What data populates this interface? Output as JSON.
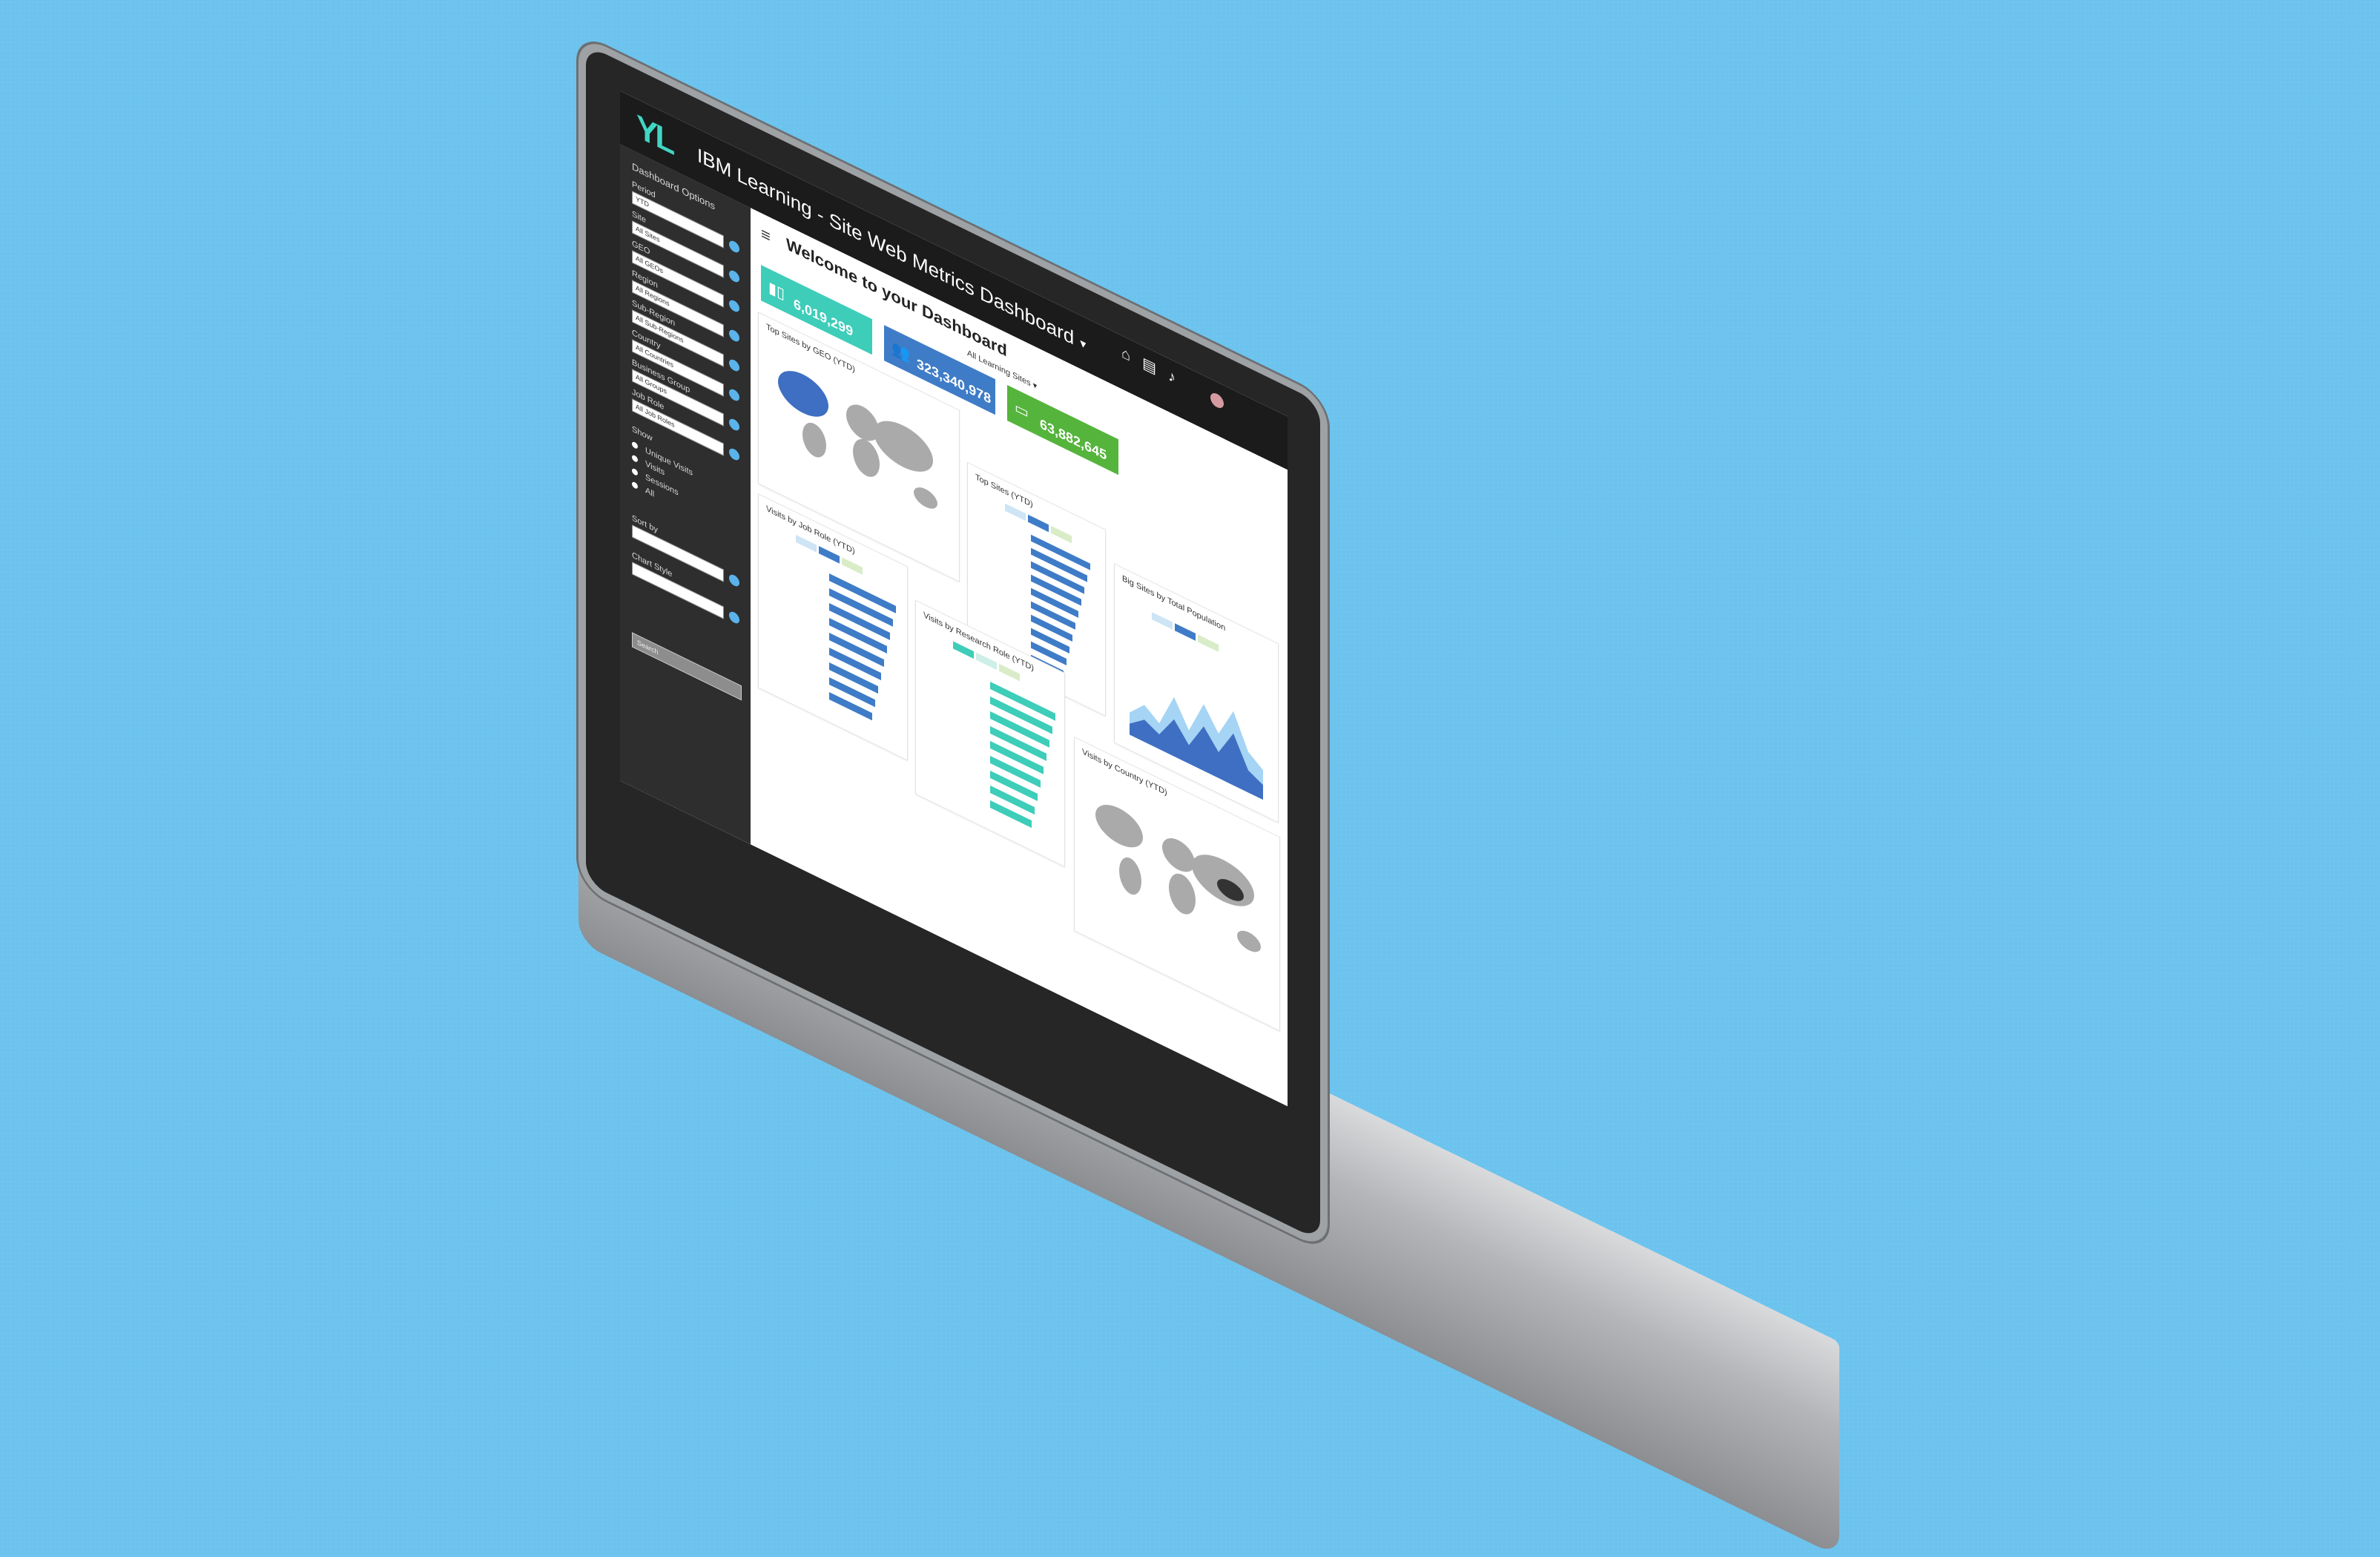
{
  "app": {
    "logo": "YL",
    "title": "IBM Learning - Site Web Metrics Dashboard"
  },
  "sidebar": {
    "heading": "Dashboard Options",
    "fields": [
      {
        "label": "Period",
        "value": "YTD"
      },
      {
        "label": "Site",
        "value": "All Sites"
      },
      {
        "label": "GEO",
        "value": "All GEOs"
      },
      {
        "label": "Region",
        "value": "All Regions"
      },
      {
        "label": "Sub-Region",
        "value": "All Sub-Regions"
      },
      {
        "label": "Country",
        "value": "All Countries"
      },
      {
        "label": "Business Group",
        "value": "All Groups"
      },
      {
        "label": "Job Role",
        "value": "All Job Roles"
      }
    ],
    "show_label": "Show",
    "show_options": [
      "Unique Visits",
      "Visits",
      "Sessions",
      "All"
    ],
    "sort_label": "Sort by",
    "sort_value": "",
    "chart_style_label": "Chart Style",
    "chart_style_value": "",
    "search_placeholder": "Search"
  },
  "main": {
    "welcome": "Welcome to your Dashboard",
    "subtitle": "",
    "filter": "All Learning Sites",
    "user_name": "",
    "kpis": [
      {
        "caption": "",
        "value": "6,019,299",
        "color": "#3ecdb9"
      },
      {
        "caption": "",
        "value": "323,340,978",
        "color": "#3f7cc7"
      },
      {
        "caption": "",
        "value": "63,882,645",
        "color": "#55b43c"
      }
    ],
    "cards": {
      "top_geo": "Top Sites by GEO (YTD)",
      "top_sites": "Top Sites (YTD)",
      "big_sites": "Big Sites by Total Population",
      "job_role": "Visits by Job Role (YTD)",
      "research_role": "Visits by Research Role (YTD)",
      "country": "Visits by Country (YTD)"
    }
  },
  "colors": {
    "topbar": "#1b1b1b",
    "sidebar": "#2e2e2e",
    "teal": "#3ecdb9",
    "blue": "#3f7cc7",
    "green": "#55b43c"
  }
}
